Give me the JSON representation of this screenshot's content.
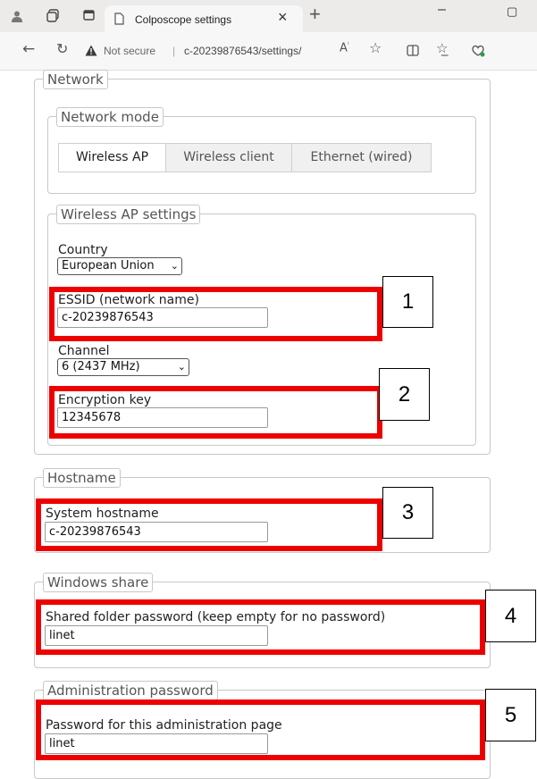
{
  "browser": {
    "tab_title": "Colposcope settings",
    "tab_close": "×",
    "new_tab": "+",
    "minimize": "–",
    "maximize": "▢",
    "not_secure": "Not secure",
    "url": "c-20239876543/settings/",
    "separator": "|"
  },
  "network": {
    "legend": "Network",
    "mode": {
      "legend": "Network mode",
      "options": [
        "Wireless AP",
        "Wireless client",
        "Ethernet (wired)"
      ],
      "selected": "Wireless AP"
    },
    "ap_settings": {
      "legend": "Wireless AP settings",
      "country_label": "Country",
      "country_value": "European Union",
      "essid_label": "ESSID (network name)",
      "essid_value": "c-20239876543",
      "channel_label": "Channel",
      "channel_value": "6 (2437 MHz)",
      "key_label": "Encryption key",
      "key_value": "12345678"
    }
  },
  "hostname": {
    "legend": "Hostname",
    "label": "System hostname",
    "value": "c-20239876543"
  },
  "windows_share": {
    "legend": "Windows share",
    "label": "Shared folder password (keep empty for no password)",
    "value": "linet"
  },
  "admin_password": {
    "legend": "Administration password",
    "label": "Password for this administration page",
    "value": "linet"
  },
  "callouts": [
    "1",
    "2",
    "3",
    "4",
    "5"
  ],
  "colors": {
    "highlight": "#ee0000"
  }
}
